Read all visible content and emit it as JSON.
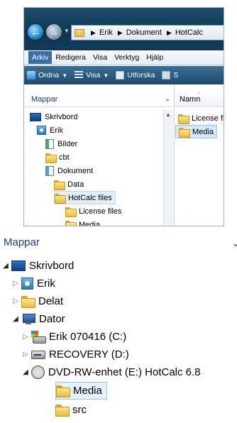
{
  "window": {
    "breadcrumb": [
      "Erik",
      "Dokument",
      "HotCalc"
    ],
    "menu": [
      "Arkiv",
      "Redigera",
      "Visa",
      "Verktyg",
      "Hjälp"
    ],
    "menu_active": "Arkiv",
    "toolbar": {
      "organize": "Ordna",
      "views": "Visa",
      "explore": "Utforska",
      "partial": "S"
    },
    "left_pane": {
      "header": "Mappar",
      "tree": [
        {
          "label": "Skrivbord",
          "icon": "desktop-icon"
        },
        {
          "label": "Erik",
          "icon": "user-folder-icon"
        },
        {
          "label": "Bilder",
          "icon": "pictures-icon"
        },
        {
          "label": "cbt",
          "icon": "folder-icon"
        },
        {
          "label": "Dokument",
          "icon": "documents-icon"
        },
        {
          "label": "Data",
          "icon": "folder-icon"
        },
        {
          "label": "HotCalc files",
          "icon": "folder-icon",
          "selected": true
        },
        {
          "label": "License files",
          "icon": "folder-icon"
        },
        {
          "label": "Media",
          "icon": "folder-icon"
        }
      ]
    },
    "right_pane": {
      "column_header": "Namn",
      "items": [
        {
          "label": "License files",
          "icon": "folder-icon"
        },
        {
          "label": "Media",
          "icon": "folder-icon",
          "selected": true
        }
      ]
    }
  },
  "zoomed_pane": {
    "header": "Mappar",
    "tree": [
      {
        "label": "Skrivbord",
        "icon": "desktop-icon",
        "expander": "open"
      },
      {
        "label": "Erik",
        "icon": "user-folder-icon",
        "expander": "closed"
      },
      {
        "label": "Delat",
        "icon": "folder-icon",
        "expander": "closed"
      },
      {
        "label": "Dator",
        "icon": "computer-icon",
        "expander": "open"
      },
      {
        "label": "Erik 070416 (C:)",
        "icon": "hard-drive-icon",
        "expander": "closed"
      },
      {
        "label": "RECOVERY (D:)",
        "icon": "drive-icon",
        "expander": "closed"
      },
      {
        "label": "DVD-RW-enhet (E:) HotCalc 6.8",
        "icon": "dvd-drive-icon",
        "expander": "open"
      },
      {
        "label": "Media",
        "icon": "folder-icon",
        "selected": true
      },
      {
        "label": "src",
        "icon": "folder-icon"
      }
    ]
  },
  "colors": {
    "selection": "#d6e8fb",
    "selection_border": "#99c6ee",
    "pane_header": "#1f3d75",
    "toolbar": "#1c4a6d",
    "menu_active": "#3a6ea5"
  }
}
